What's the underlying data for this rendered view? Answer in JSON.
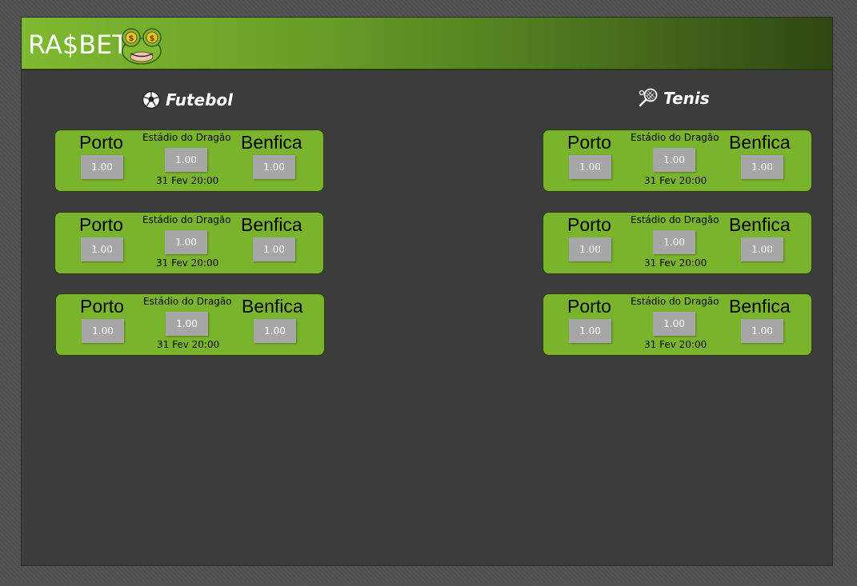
{
  "header": {
    "logo_text": "RA$BET",
    "logo_icon": "frog-mascot-icon"
  },
  "sections": [
    {
      "title": "Futebol",
      "icon": "soccer-ball-icon",
      "games": [
        {
          "home": "Porto",
          "away": "Benfica",
          "venue": "Estádio do Dragão",
          "datetime": "31 Fev 20:00",
          "odd_home": "1.00",
          "odd_draw": "1.00",
          "odd_away": "1.00"
        },
        {
          "home": "Porto",
          "away": "Benfica",
          "venue": "Estádio do Dragão",
          "datetime": "31 Fev 20:00",
          "odd_home": "1.00",
          "odd_draw": "1.00",
          "odd_away": "1.00"
        },
        {
          "home": "Porto",
          "away": "Benfica",
          "venue": "Estádio do Dragão",
          "datetime": "31 Fev 20:00",
          "odd_home": "1.00",
          "odd_draw": "1.00",
          "odd_away": "1.00"
        }
      ]
    },
    {
      "title": "Tenis",
      "icon": "tennis-racket-icon",
      "games": [
        {
          "home": "Porto",
          "away": "Benfica",
          "venue": "Estádio do Dragão",
          "datetime": "31 Fev 20:00",
          "odd_home": "1.00",
          "odd_draw": "1.00",
          "odd_away": "1.00"
        },
        {
          "home": "Porto",
          "away": "Benfica",
          "venue": "Estádio do Dragão",
          "datetime": "31 Fev 20:00",
          "odd_home": "1.00",
          "odd_draw": "1.00",
          "odd_away": "1.00"
        },
        {
          "home": "Porto",
          "away": "Benfica",
          "venue": "Estádio do Dragão",
          "datetime": "31 Fev 20:00",
          "odd_home": "1.00",
          "odd_draw": "1.00",
          "odd_away": "1.00"
        }
      ]
    }
  ],
  "colors": {
    "card": "#7ab42c",
    "odd_button": "#a6a6a6",
    "background": "#3c3c3c",
    "header_start": "#7fba30",
    "header_end": "#2f4712"
  }
}
